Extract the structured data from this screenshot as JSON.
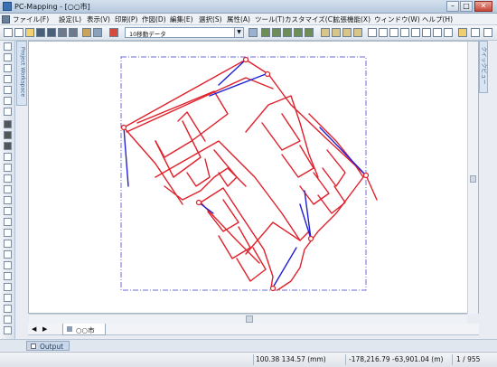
{
  "window": {
    "title": "PC-Mapping - [○○市]",
    "minimize_glyph": "–",
    "maximize_glyph": "□",
    "close_glyph": "✕"
  },
  "menu": [
    "ファイル(F)",
    "設定(L)",
    "表示(V)",
    "印刷(P)",
    "作図(D)",
    "編集(E)",
    "選択(S)",
    "属性(A)",
    "ツール(T)",
    "カスタマイズ(C)",
    "拡張機能(X)",
    "ウィンドウ(W)",
    "ヘルプ(H)"
  ],
  "toolbar": {
    "layer_select": "10移動データ"
  },
  "left_panel": {
    "label": "Project Workspace"
  },
  "right_panel": {
    "label": "クイックビュー"
  },
  "document_tab": {
    "label": "○○市"
  },
  "output_tab": {
    "label": "Output"
  },
  "status": {
    "paper_coords": "100.38 134.57 (mm)",
    "map_coords": "-178,216.79 -63,901.04 (m)",
    "page": "1 / 955"
  },
  "colors": {
    "road_lines": "#e0202a",
    "vectors": "#1f1fd6",
    "frame": "#6b6bd8",
    "accent": "#3a6fb0"
  }
}
